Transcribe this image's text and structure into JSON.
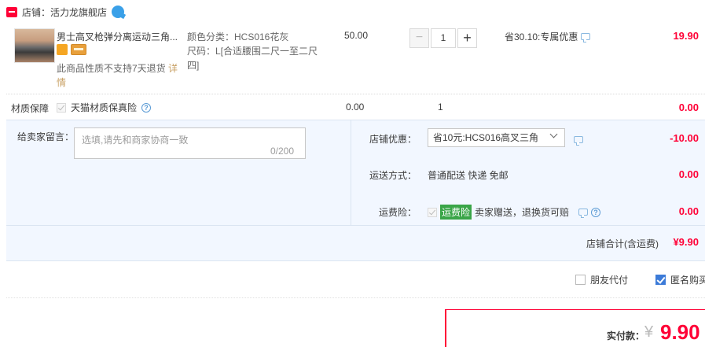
{
  "shop": {
    "label": "店铺：",
    "name": "活力龙旗舰店",
    "ww_badge": "1"
  },
  "item": {
    "title": "男士高叉枪弹分离运动三角...",
    "no_return": "此商品性质不支持7天退货",
    "detail_link": "详情",
    "sku_color": "颜色分类：HCS016花灰",
    "sku_size": "尺码：L[合适腰围二尺一至二尺四]",
    "price": "50.00",
    "qty": "1",
    "qty_minus": "−",
    "qty_plus": "+",
    "promo": "省30.10:专属优惠",
    "subtotal": "19.90"
  },
  "material": {
    "label": "材质保障",
    "option": "天猫材质保真险",
    "price": "0.00",
    "qty": "1",
    "total": "0.00"
  },
  "message": {
    "label": "给卖家留言：",
    "placeholder": "选填,请先和商家协商一致",
    "count": "0/200"
  },
  "shop_discount": {
    "label": "店铺优惠：",
    "selected": "省10元:HCS016高叉三角",
    "value": "-10.00"
  },
  "shipping": {
    "label": "运送方式：",
    "method": "普通配送 快递 免邮",
    "value": "0.00"
  },
  "freight_insurance": {
    "label": "运费险：",
    "tag": "运费险",
    "desc": "卖家赠送，退换货可赔",
    "value": "0.00"
  },
  "shop_total": {
    "label": "店铺合计(含运费)",
    "value": "¥9.90"
  },
  "options": {
    "friend_pay": "朋友代付",
    "anonymous": "匿名购买"
  },
  "payment": {
    "label": "实付款：",
    "currency": "¥",
    "amount": "9.90"
  },
  "colors": {
    "accent_red": "#ff0036",
    "panel_bg": "#f2f7ff",
    "insurance_green": "#3aa548"
  }
}
